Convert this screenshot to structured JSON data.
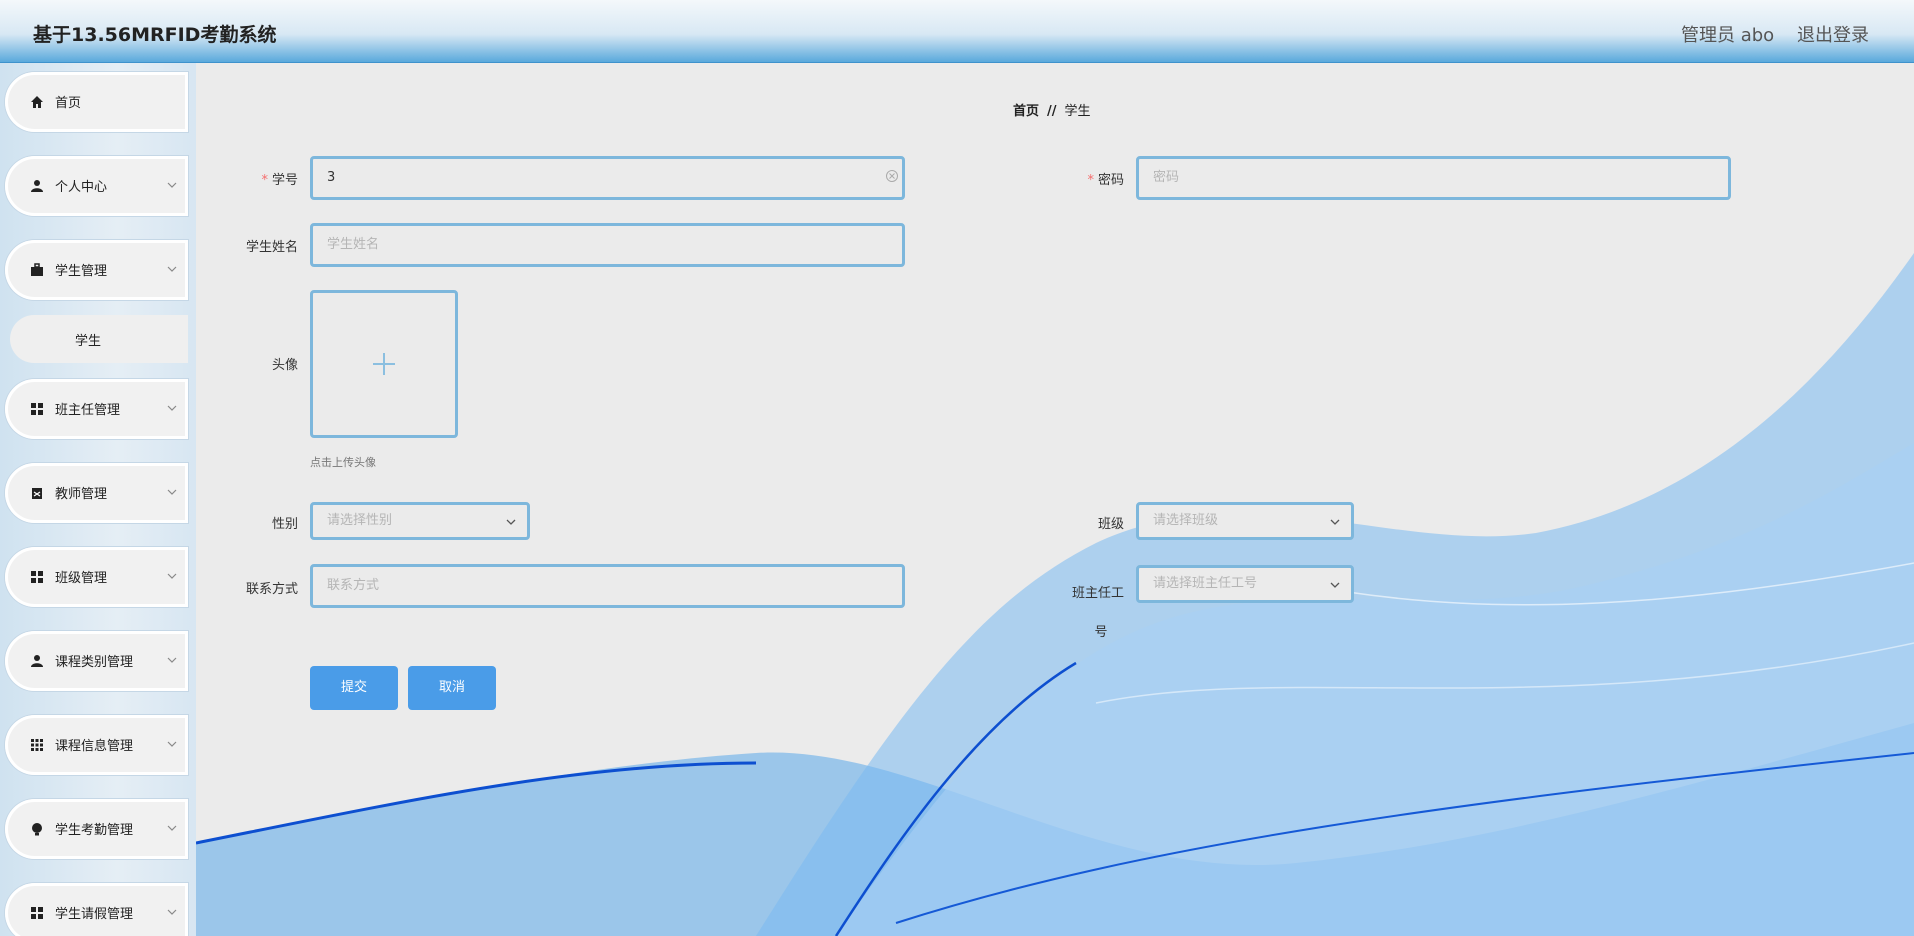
{
  "header": {
    "title": "基于13.56MRFID考勤系统",
    "user": "管理员 abo",
    "logout": "退出登录"
  },
  "sidebar": {
    "items": [
      {
        "label": "首页",
        "icon": "home-icon"
      },
      {
        "label": "个人中心",
        "icon": "user-icon"
      },
      {
        "label": "学生管理",
        "icon": "briefcase-icon"
      },
      {
        "label": "班主任管理",
        "icon": "grid-icon"
      },
      {
        "label": "教师管理",
        "icon": "clipboard-icon"
      },
      {
        "label": "班级管理",
        "icon": "grid-icon"
      },
      {
        "label": "课程类别管理",
        "icon": "user-icon"
      },
      {
        "label": "课程信息管理",
        "icon": "dots-grid-icon"
      },
      {
        "label": "学生考勤管理",
        "icon": "bulb-icon"
      },
      {
        "label": "学生请假管理",
        "icon": "grid-icon"
      }
    ],
    "sub_item": "学生"
  },
  "breadcrumb": {
    "home": "首页",
    "sep": "//",
    "current": "学生"
  },
  "form": {
    "student_id": {
      "label": "学号",
      "value": "3"
    },
    "password": {
      "label": "密码",
      "placeholder": "密码"
    },
    "name": {
      "label": "学生姓名",
      "placeholder": "学生姓名"
    },
    "avatar": {
      "label": "头像",
      "hint": "点击上传头像"
    },
    "gender": {
      "label": "性别",
      "placeholder": "请选择性别"
    },
    "class": {
      "label": "班级",
      "placeholder": "请选择班级"
    },
    "contact": {
      "label": "联系方式",
      "placeholder": "联系方式"
    },
    "teacher": {
      "label_line1": "班主任工",
      "label_line2": "号",
      "placeholder": "请选择班主任工号"
    },
    "submit": "提交",
    "cancel": "取消"
  },
  "colors": {
    "accent": "#4a9ce8",
    "border": "#7db7dc",
    "required": "#f56c6c"
  }
}
